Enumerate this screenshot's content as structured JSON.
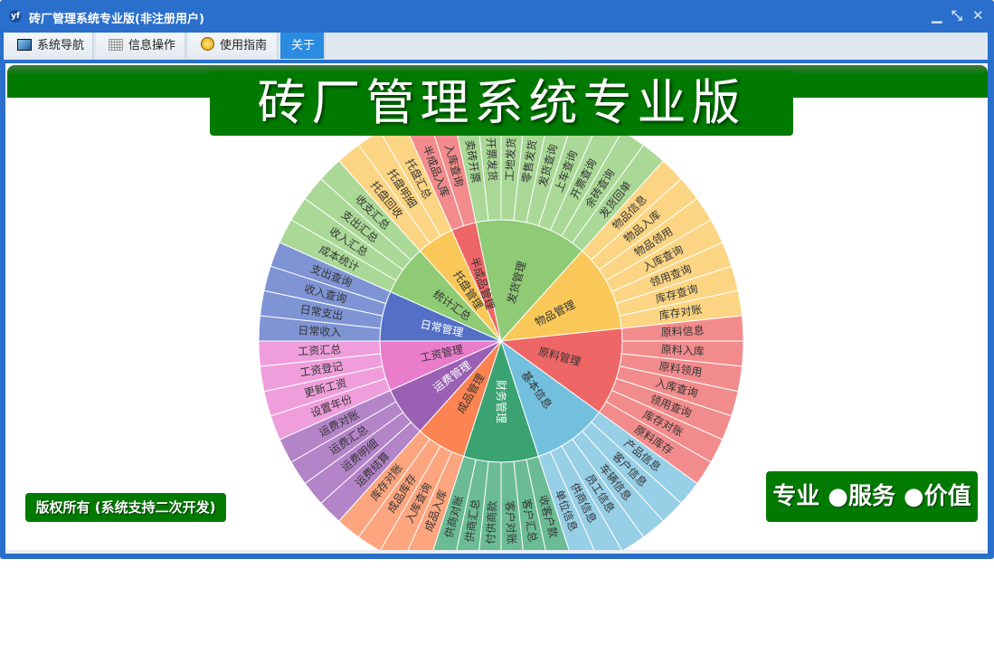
{
  "window": {
    "title": "砖厂管理系统专业版(非注册用户)",
    "app_icon": "yf",
    "minimize": "▁",
    "restore": "⤡",
    "close": "✕"
  },
  "tabs": [
    {
      "label": "系统导航",
      "icon": "monitor-icon"
    },
    {
      "label": "信息操作",
      "icon": "grid-icon"
    },
    {
      "label": "使用指南",
      "icon": "help-icon"
    },
    {
      "label": "关于",
      "icon": "",
      "active": true
    }
  ],
  "banner": {
    "title": "砖厂管理系统专业版"
  },
  "copyright": "版权所有 (系统支持二次开发)",
  "slogan": "专业 ●服务 ●价值",
  "sunburst": [
    {
      "name": "发货管理",
      "inner": "#8fca74",
      "outer": "#aad897",
      "label": "#333",
      "children": [
        "卖砖开票",
        "开票发货",
        "工地发货",
        "零售发货",
        "发货查询",
        "上车查询",
        "开票查询",
        "余砖查询",
        "发货回单"
      ]
    },
    {
      "name": "物品管理",
      "inner": "#f9c858",
      "outer": "#fbd583",
      "label": "#333",
      "children": [
        "物品信息",
        "物品入库",
        "物品领用",
        "入库查询",
        "领用查询",
        "库存查询",
        "库存对账"
      ]
    },
    {
      "name": "原料管理",
      "inner": "#ee6666",
      "outer": "#f28c8c",
      "label": "#333",
      "children": [
        "原料信息",
        "原料入库",
        "原料领用",
        "入库查询",
        "领用查询",
        "库存对账",
        "原料库存"
      ]
    },
    {
      "name": "基本信息",
      "inner": "#73c0de",
      "outer": "#97cfe6",
      "label": "#333",
      "children": [
        "产品信息",
        "客户信息",
        "车辆信息",
        "员工信息",
        "供商信息",
        "单位信息"
      ]
    },
    {
      "name": "财务管理",
      "inner": "#3ba272",
      "outer": "#6bbb95",
      "label": "#fff",
      "children": [
        "收客户款",
        "客户汇总",
        "客户对账",
        "付供商款",
        "供商汇总",
        "供商对账"
      ]
    },
    {
      "name": "成品管理",
      "inner": "#fc8452",
      "outer": "#fda57e",
      "label": "#333",
      "children": [
        "成品入库",
        "入库查询",
        "成品库存",
        "库存对账"
      ]
    },
    {
      "name": "运费管理",
      "inner": "#9a60b4",
      "outer": "#b384c7",
      "label": "#fff",
      "children": [
        "运费结算",
        "运费明细",
        "运费汇总",
        "运费对账"
      ]
    },
    {
      "name": "工资管理",
      "inner": "#ea7ccc",
      "outer": "#ef9edb",
      "label": "#333",
      "children": [
        "设置年份",
        "更新工资",
        "工资登记",
        "工资汇总"
      ]
    },
    {
      "name": "日常管理",
      "inner": "#5470c6",
      "outer": "#7f94d4",
      "label": "#fff",
      "children": [
        "日常收入",
        "日常支出",
        "收入查询",
        "支出查询"
      ]
    },
    {
      "name": "统计汇总",
      "inner": "#8fca74",
      "outer": "#aad897",
      "label": "#333",
      "children": [
        "成本统计",
        "收入汇总",
        "支出汇总",
        "收支汇总"
      ]
    },
    {
      "name": "托盘管理",
      "inner": "#f9c858",
      "outer": "#fbd583",
      "label": "#333",
      "children": [
        "托盘回收",
        "托盘明细",
        "托盘汇总"
      ]
    },
    {
      "name": "半成品管理",
      "inner": "#ee6666",
      "outer": "#f28c8c",
      "label": "#333",
      "children": [
        "半成品入库",
        "入库查询"
      ]
    }
  ]
}
